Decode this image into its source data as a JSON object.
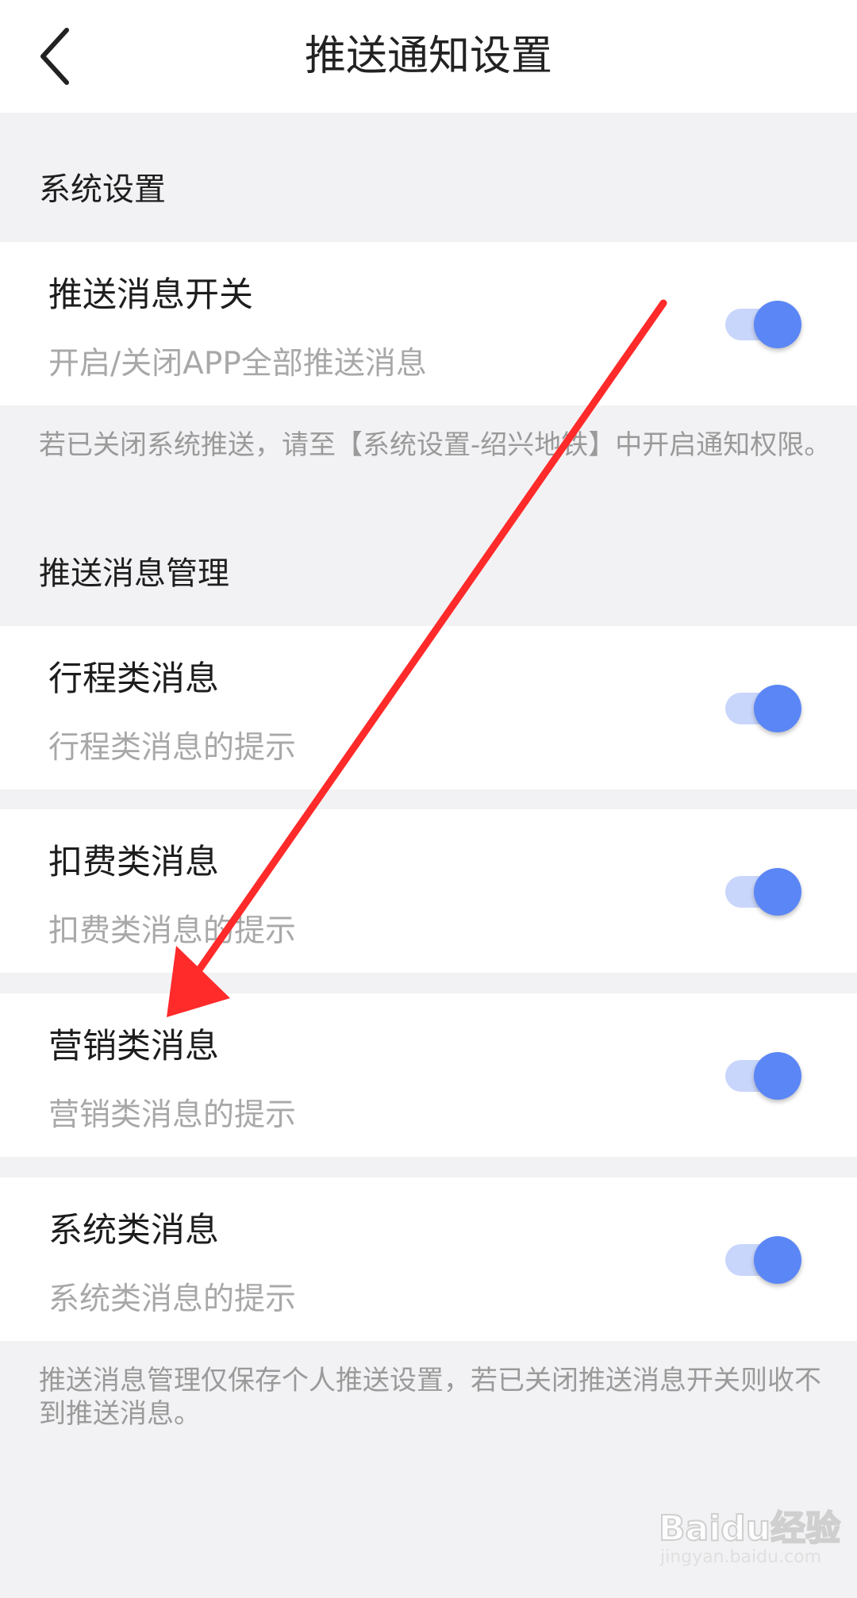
{
  "header": {
    "title": "推送通知设置"
  },
  "sections": {
    "system": {
      "label": "系统设置"
    },
    "management": {
      "label": "推送消息管理"
    }
  },
  "items": [
    {
      "title": "推送消息开关",
      "subtitle": "开启/关闭APP全部推送消息",
      "enabled": true
    },
    {
      "title": "行程类消息",
      "subtitle": "行程类消息的提示",
      "enabled": true
    },
    {
      "title": "扣费类消息",
      "subtitle": "扣费类消息的提示",
      "enabled": true
    },
    {
      "title": "营销类消息",
      "subtitle": "营销类消息的提示",
      "enabled": true
    },
    {
      "title": "系统类消息",
      "subtitle": "系统类消息的提示",
      "enabled": true
    }
  ],
  "notes": {
    "system": "若已关闭系统推送，请至【系统设置-绍兴地铁】中开启通知权限。",
    "management": "推送消息管理仅保存个人推送设置，若已关闭推送消息开关则收不到推送消息。"
  },
  "watermark": {
    "main": "Baidu经验",
    "sub": "jingyan.baidu.com"
  },
  "colors": {
    "accent": "#5b86f6",
    "track": "#c9d6fb",
    "annotation": "#ff2a2a"
  },
  "icons": {
    "back": "chevron-left-icon",
    "annotation": "arrow-icon"
  }
}
